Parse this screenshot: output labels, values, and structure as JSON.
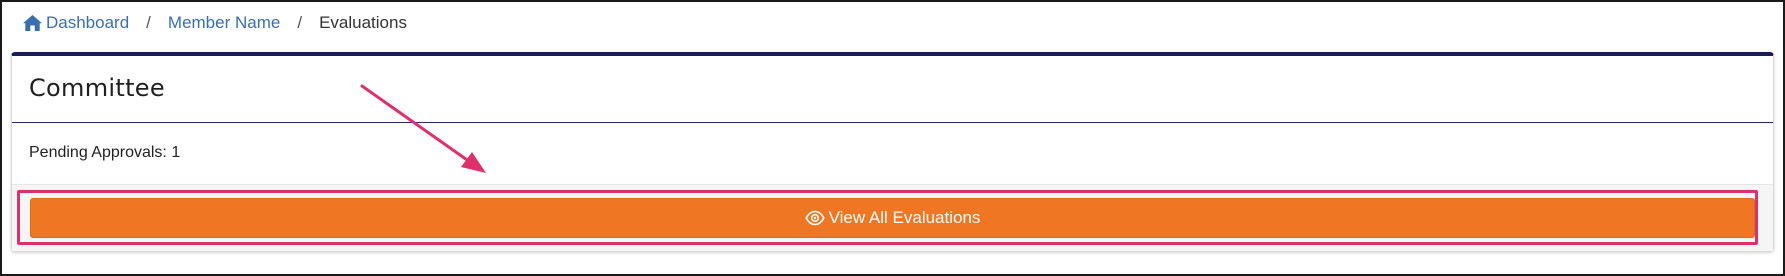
{
  "breadcrumb": {
    "items": [
      {
        "label": "Dashboard",
        "icon": "home-icon"
      },
      {
        "label": "Member Name"
      },
      {
        "label": "Evaluations"
      }
    ],
    "separator": "/"
  },
  "card": {
    "title": "Committee",
    "pending_label": "Pending Approvals: 1",
    "view_button_label": "View All Evaluations",
    "view_button_icon": "eye-icon"
  },
  "colors": {
    "link": "#3a6fae",
    "card_top_border": "#1b1b5c",
    "button_bg": "#ef7622",
    "annotation": "#e0306a"
  }
}
